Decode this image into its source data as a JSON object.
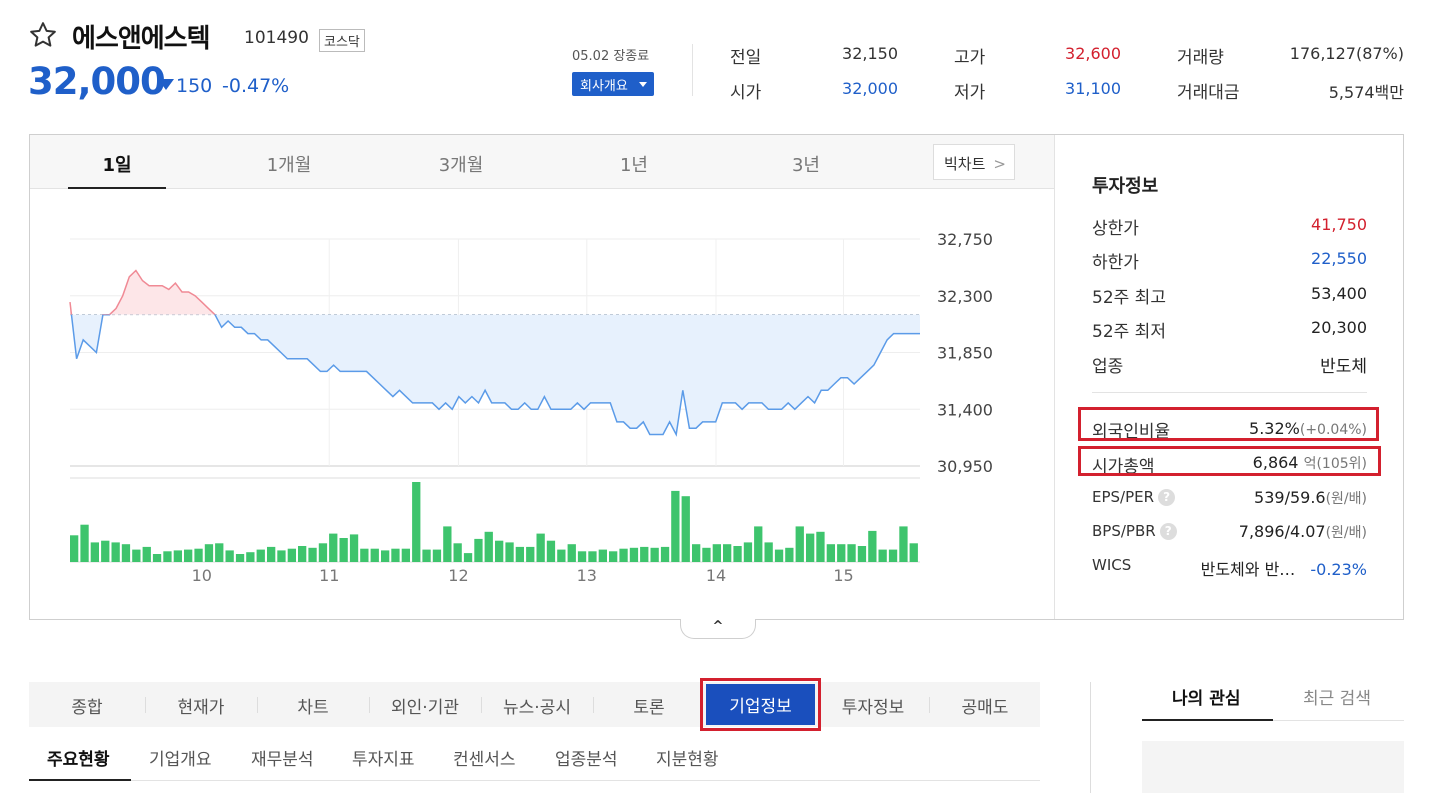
{
  "stock": {
    "name": "에스앤에스텍",
    "code": "101490",
    "market": "코스닥",
    "price": "32,000",
    "change": "150",
    "change_pct": "-0.47%",
    "close_note": "05.02 장종료",
    "profile_button": "회사개요"
  },
  "summary": {
    "prev_label": "전일",
    "prev": "32,150",
    "open_label": "시가",
    "open": "32,000",
    "high_label": "고가",
    "high": "32,600",
    "low_label": "저가",
    "low": "31,100",
    "volume_label": "거래량",
    "volume": "176,127(87%)",
    "amount_label": "거래대금",
    "amount": "5,574백만"
  },
  "period_tabs": [
    "1일",
    "1개월",
    "3개월",
    "1년",
    "3년"
  ],
  "bigchart_label": "빅차트",
  "collapse_icon": "chevron-up-icon",
  "colors": {
    "up": "#d3202e",
    "down": "#1f5fc9",
    "line": "#5b9be8",
    "volume": "#3ec46d"
  },
  "chart_data": {
    "type": "line",
    "title": "",
    "y_ticks": [
      "32,750",
      "32,300",
      "31,850",
      "31,400",
      "30,950"
    ],
    "ylim": [
      30950,
      32750
    ],
    "baseline": 32150,
    "x_ticks": [
      "10",
      "11",
      "12",
      "13",
      "14",
      "15"
    ],
    "price": [
      32250,
      31800,
      31950,
      31900,
      31850,
      32150,
      32150,
      32200,
      32300,
      32450,
      32500,
      32420,
      32380,
      32380,
      32380,
      32350,
      32400,
      32330,
      32330,
      32300,
      32250,
      32200,
      32150,
      32050,
      32100,
      32050,
      32050,
      32000,
      32000,
      31950,
      31950,
      31900,
      31850,
      31800,
      31800,
      31800,
      31800,
      31750,
      31700,
      31700,
      31750,
      31700,
      31700,
      31700,
      31700,
      31700,
      31650,
      31600,
      31550,
      31500,
      31550,
      31500,
      31450,
      31450,
      31450,
      31450,
      31400,
      31450,
      31400,
      31500,
      31450,
      31500,
      31450,
      31550,
      31450,
      31450,
      31450,
      31400,
      31400,
      31450,
      31400,
      31400,
      31500,
      31400,
      31400,
      31400,
      31400,
      31450,
      31400,
      31450,
      31450,
      31450,
      31450,
      31300,
      31300,
      31250,
      31250,
      31300,
      31200,
      31200,
      31200,
      31300,
      31200,
      31550,
      31250,
      31250,
      31300,
      31300,
      31300,
      31450,
      31450,
      31450,
      31400,
      31450,
      31450,
      31450,
      31400,
      31400,
      31400,
      31450,
      31400,
      31450,
      31500,
      31450,
      31550,
      31550,
      31600,
      31650,
      31650,
      31600,
      31650,
      31700,
      31750,
      31850,
      31950,
      32000,
      32000,
      32000,
      32000,
      32000
    ],
    "volume": [
      30,
      42,
      22,
      24,
      22,
      20,
      14,
      17,
      9,
      12,
      13,
      14,
      15,
      20,
      21,
      13,
      9,
      11,
      14,
      17,
      13,
      15,
      18,
      16,
      21,
      32,
      27,
      31,
      15,
      15,
      13,
      15,
      15,
      90,
      14,
      14,
      40,
      21,
      10,
      26,
      34,
      24,
      22,
      17,
      17,
      32,
      24,
      14,
      20,
      12,
      12,
      14,
      12,
      15,
      16,
      17,
      16,
      17,
      80,
      74,
      20,
      16,
      20,
      20,
      18,
      22,
      40,
      22,
      14,
      16,
      40,
      32,
      34,
      20,
      20,
      20,
      18,
      35,
      14,
      14,
      40,
      21
    ]
  },
  "invest": {
    "title": "투자정보",
    "upper_label": "상한가",
    "upper": "41,750",
    "lower_label": "하한가",
    "lower": "22,550",
    "w52_high_label": "52주 최고",
    "w52_high": "53,400",
    "w52_low_label": "52주 최저",
    "w52_low": "20,300",
    "sector_label": "업종",
    "sector": "반도체",
    "foreign_label": "외국인비율",
    "foreign": "5.32%",
    "foreign_chg": "(+0.04%)",
    "mcap_label": "시가총액",
    "mcap": "6,864",
    "mcap_unit": "억",
    "mcap_rank": "(105위)",
    "eps_label": "EPS/PER",
    "eps": "539/59.6",
    "eps_unit": "(원/배)",
    "bps_label": "BPS/PBR",
    "bps": "7,896/4.07",
    "bps_unit": "(원/배)",
    "wics_label": "WICS",
    "wics": "반도체와 반…",
    "wics_chg": "-0.23%",
    "help_icon": "?"
  },
  "main_tabs": [
    "종합",
    "현재가",
    "차트",
    "외인·기관",
    "뉴스·공시",
    "토론",
    "기업정보",
    "투자정보",
    "공매도"
  ],
  "sub_tabs": [
    "주요현황",
    "기업개요",
    "재무분석",
    "투자지표",
    "컨센서스",
    "업종분석",
    "지분현황"
  ],
  "right_tabs": [
    "나의 관심",
    "최근 검색"
  ]
}
